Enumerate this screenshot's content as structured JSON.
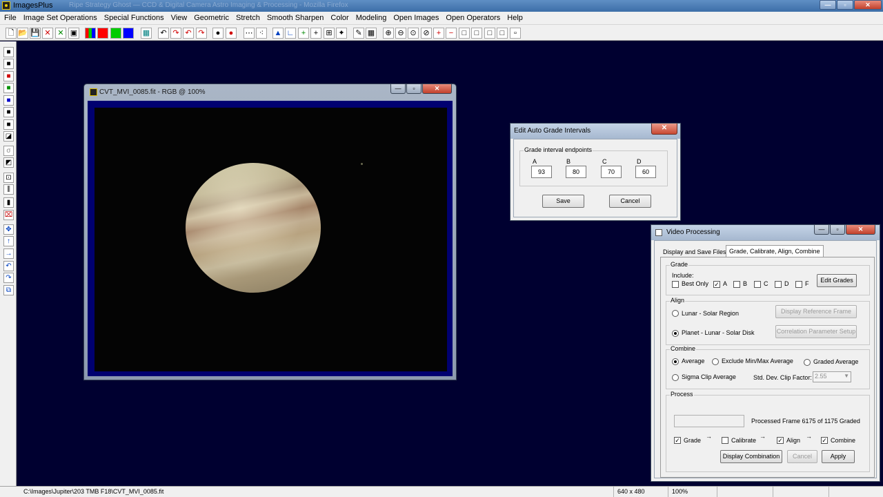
{
  "app": {
    "title": "ImagesPlus",
    "background_title": "Ripe Strategy Ghost — CCD & Digital Camera Astro Imaging & Processing - Mozilla Firefox"
  },
  "window_controls": {
    "minimize": "—",
    "maximize": "▫",
    "close": "✕"
  },
  "menu": [
    "File",
    "Image Set Operations",
    "Special Functions",
    "View",
    "Geometric",
    "Stretch",
    "Smooth Sharpen",
    "Color",
    "Modeling",
    "Open Images",
    "Open Operators",
    "Help"
  ],
  "toolbar": {
    "buttons": [
      {
        "name": "new-file-icon",
        "glyph": "🗋"
      },
      {
        "name": "open-folder-icon",
        "glyph": "📂"
      },
      {
        "name": "save-icon",
        "glyph": "💾"
      },
      {
        "name": "close-red-x-icon",
        "glyph": "✕"
      },
      {
        "name": "close-green-x-icon",
        "glyph": "✕"
      },
      {
        "name": "copy-icon",
        "glyph": "▣"
      },
      {
        "name": "rgb-channels-icon",
        "glyph": "▥"
      },
      {
        "name": "red-channel-icon",
        "glyph": ""
      },
      {
        "name": "green-channel-icon",
        "glyph": ""
      },
      {
        "name": "blue-channel-icon",
        "glyph": ""
      },
      {
        "name": "grayscale-icon",
        "glyph": "▦"
      },
      {
        "name": "undo-icon",
        "glyph": "↶"
      },
      {
        "name": "redo-icon",
        "glyph": "↷"
      },
      {
        "name": "undo-red-icon",
        "glyph": "↶"
      },
      {
        "name": "redo-red-icon",
        "glyph": "↷"
      },
      {
        "name": "record-icon",
        "glyph": "●"
      },
      {
        "name": "record-red-icon",
        "glyph": "●"
      },
      {
        "name": "dotted-line-icon",
        "glyph": "⋯"
      },
      {
        "name": "scatter-points-icon",
        "glyph": "⁖"
      },
      {
        "name": "histogram-icon",
        "glyph": "▲"
      },
      {
        "name": "curve-icon",
        "glyph": "∟"
      },
      {
        "name": "crosshair-green-icon",
        "glyph": "+"
      },
      {
        "name": "crosshair-icon",
        "glyph": "+"
      },
      {
        "name": "grid-dim-icon",
        "glyph": "⊞"
      },
      {
        "name": "stars-icon",
        "glyph": "✦"
      },
      {
        "name": "pencil-icon",
        "glyph": "✎"
      },
      {
        "name": "grid-icon",
        "glyph": "▦"
      },
      {
        "name": "zoom-in-icon",
        "glyph": "⊕"
      },
      {
        "name": "zoom-out-icon",
        "glyph": "⊖"
      },
      {
        "name": "zoom-fit-icon",
        "glyph": "⊙"
      },
      {
        "name": "zoom-actual-icon",
        "glyph": "⊘"
      },
      {
        "name": "add-red-icon",
        "glyph": "+"
      },
      {
        "name": "subtract-red-icon",
        "glyph": "−"
      },
      {
        "name": "box-1-icon",
        "glyph": "□"
      },
      {
        "name": "box-2-icon",
        "glyph": "□"
      },
      {
        "name": "box-3-icon",
        "glyph": "□"
      },
      {
        "name": "box-4-icon",
        "glyph": "□"
      },
      {
        "name": "box-small-icon",
        "glyph": "▫"
      }
    ]
  },
  "left_toolbar": [
    {
      "name": "save-icon",
      "glyph": "■"
    },
    {
      "name": "black-square-icon",
      "glyph": "■"
    },
    {
      "name": "red-channel-icon",
      "glyph": "■"
    },
    {
      "name": "green-channel-icon",
      "glyph": "■"
    },
    {
      "name": "blue-channel-icon",
      "glyph": "■"
    },
    {
      "name": "black-white-icon",
      "glyph": "■"
    },
    {
      "name": "invert-icon",
      "glyph": "■"
    },
    {
      "name": "mask-icon",
      "glyph": "◪"
    },
    {
      "name": "gamma-icon",
      "glyph": "σ"
    },
    {
      "name": "gradient-icon",
      "glyph": "◩"
    },
    {
      "name": "center-icon",
      "glyph": "⊡"
    },
    {
      "name": "bars-icon",
      "glyph": "⫼"
    },
    {
      "name": "vertical-bar-icon",
      "glyph": "▮"
    },
    {
      "name": "crop-icon",
      "glyph": "⌧"
    },
    {
      "name": "move-icon",
      "glyph": "✥"
    },
    {
      "name": "arrow-up-icon",
      "glyph": "↑"
    },
    {
      "name": "arrow-right-icon",
      "glyph": "→"
    },
    {
      "name": "rotate-left-icon",
      "glyph": "↶"
    },
    {
      "name": "rotate-right-icon",
      "glyph": "↷"
    },
    {
      "name": "flip-icon",
      "glyph": "⧉"
    }
  ],
  "image_window": {
    "title": "CVT_MVI_0085.fit - RGB @ 100%"
  },
  "edit_grades_dialog": {
    "title": "Edit Auto Grade Intervals",
    "group_label": "Grade interval endpoints",
    "fields": [
      {
        "label": "A",
        "value": "93"
      },
      {
        "label": "B",
        "value": "80"
      },
      {
        "label": "C",
        "value": "70"
      },
      {
        "label": "D",
        "value": "60"
      }
    ],
    "save_label": "Save",
    "cancel_label": "Cancel"
  },
  "video_dialog": {
    "title": "Video Processing",
    "tabs": [
      "Display and Save Files",
      "Grade, Calibrate, Align, Combine"
    ],
    "grade": {
      "label": "Grade",
      "include_label": "Include:",
      "checks": [
        {
          "label": "Best Only",
          "checked": false
        },
        {
          "label": "A",
          "checked": true
        },
        {
          "label": "B",
          "checked": false
        },
        {
          "label": "C",
          "checked": false
        },
        {
          "label": "D",
          "checked": false
        },
        {
          "label": "F",
          "checked": false
        }
      ],
      "edit_button": "Edit Grades"
    },
    "align": {
      "label": "Align",
      "option1": "Lunar - Solar Region",
      "option2": "Planet - Lunar - Solar Disk",
      "button1": "Display Reference Frame",
      "button2": "Correlation Parameter Setup"
    },
    "combine": {
      "label": "Combine",
      "average": "Average",
      "exclude": "Exclude Min/Max Average",
      "graded": "Graded Average",
      "sigma": "Sigma Clip Average",
      "clip_label": "Std. Dev. Clip Factor:",
      "clip_value": "2.55"
    },
    "process": {
      "label": "Process",
      "status": "Processed Frame 6175 of 1175 Graded",
      "steps": [
        {
          "label": "Grade",
          "checked": true
        },
        {
          "label": "Calibrate",
          "checked": false
        },
        {
          "label": "Align",
          "checked": true
        },
        {
          "label": "Combine",
          "checked": true
        }
      ],
      "arrow": "→",
      "display_button": "Display Combination",
      "cancel_button": "Cancel",
      "apply_button": "Apply"
    }
  },
  "status": {
    "path": "C:\\Images\\Jupiter\\203 TMB F18\\CVT_MVI_0085.fit",
    "dimensions": "640 x 480",
    "zoom": "100%"
  },
  "colors": {
    "workspace": "#000030",
    "canvas_border": "#000070"
  }
}
